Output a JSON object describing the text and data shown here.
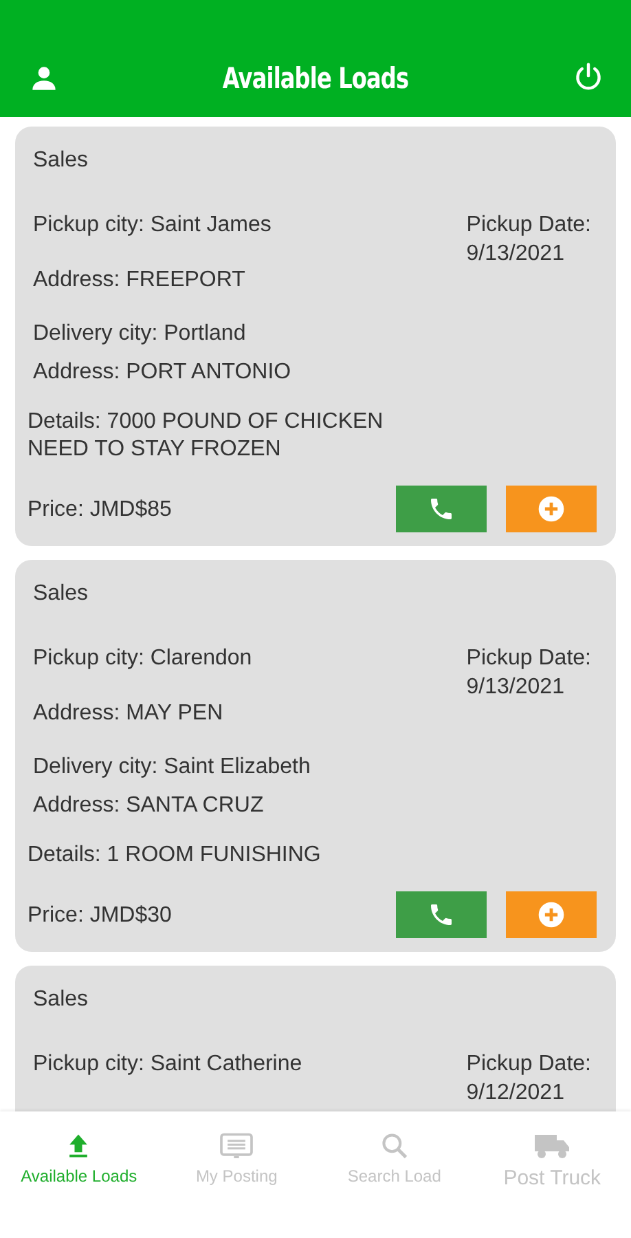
{
  "header": {
    "title": "Available Loads"
  },
  "loads": [
    {
      "category": "Sales",
      "pickup_city": "Pickup city: Saint James",
      "pickup_date_label": "Pickup Date:",
      "pickup_date": "9/13/2021",
      "pickup_address": "Address: FREEPORT",
      "delivery_city": "Delivery city: Portland",
      "delivery_address": "Address: PORT ANTONIO",
      "details": "Details: 7000 POUND OF CHICKEN NEED TO STAY FROZEN",
      "price": "Price: JMD$85"
    },
    {
      "category": "Sales",
      "pickup_city": "Pickup city: Clarendon",
      "pickup_date_label": "Pickup Date:",
      "pickup_date": "9/13/2021",
      "pickup_address": "Address: MAY PEN",
      "delivery_city": "Delivery city: Saint Elizabeth",
      "delivery_address": "Address: SANTA CRUZ",
      "details": "Details: 1 ROOM FUNISHING",
      "price": "Price: JMD$30"
    },
    {
      "category": "Sales",
      "pickup_city": "Pickup city: Saint Catherine",
      "pickup_date_label": "Pickup Date:",
      "pickup_date": "9/12/2021"
    }
  ],
  "bottom_nav": [
    {
      "kind": "upload",
      "label": "Available Loads",
      "selected": true
    },
    {
      "kind": "posting",
      "label": "My Posting",
      "selected": false
    },
    {
      "kind": "search",
      "label": "Search Load",
      "selected": false
    },
    {
      "kind": "truck",
      "label": "Post Truck",
      "selected": false
    }
  ]
}
